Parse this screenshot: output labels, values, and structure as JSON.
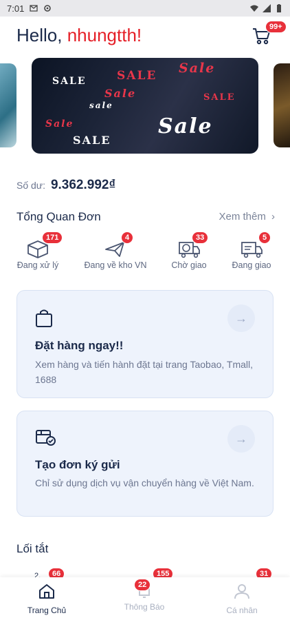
{
  "status_bar": {
    "time": "7:01"
  },
  "header": {
    "greeting": "Hello, ",
    "username": "nhungtth!",
    "cart_badge": "99+"
  },
  "banner": {
    "words": [
      "SALE",
      "SALE",
      "Sale",
      "Sale",
      "SALE",
      "Sale",
      "sale",
      "SALE",
      "Sale"
    ]
  },
  "balance": {
    "label": "Số dư:",
    "amount": "9.362.992₫"
  },
  "overview": {
    "title": "Tổng Quan Đơn",
    "see_more": "Xem thêm",
    "stats": [
      {
        "label": "Đang xử lý",
        "count": "171",
        "icon": "box-icon"
      },
      {
        "label": "Đang về kho VN",
        "count": "4",
        "icon": "plane-icon"
      },
      {
        "label": "Chờ giao",
        "count": "33",
        "icon": "truck-clock-icon"
      },
      {
        "label": "Đang giao",
        "count": "5",
        "icon": "delivery-truck-icon"
      }
    ]
  },
  "cards": [
    {
      "title": "Đặt hàng ngay!!",
      "desc": "Xem hàng và tiến hành đặt tại trang Taobao, Tmall, 1688",
      "icon": "shopping-bag-icon"
    },
    {
      "title": "Tạo đơn ký gửi",
      "desc": "Chỉ sử dụng dịch vụ vận chuyển hàng về Việt Nam.",
      "icon": "package-check-icon"
    }
  ],
  "shortcuts": {
    "title": "Lối tắt",
    "badges": [
      "66",
      "155",
      "31"
    ]
  },
  "bottom_nav": [
    {
      "label": "Trang Chủ",
      "icon": "home-icon",
      "active": true
    },
    {
      "label": "Thông Báo",
      "icon": "bell-icon",
      "badge": "22",
      "active": false
    },
    {
      "label": "Cá nhân",
      "icon": "user-icon",
      "active": false
    }
  ],
  "colors": {
    "accent_red": "#e52028",
    "navy": "#1b2a4a",
    "card_bg": "#eef3fc"
  }
}
